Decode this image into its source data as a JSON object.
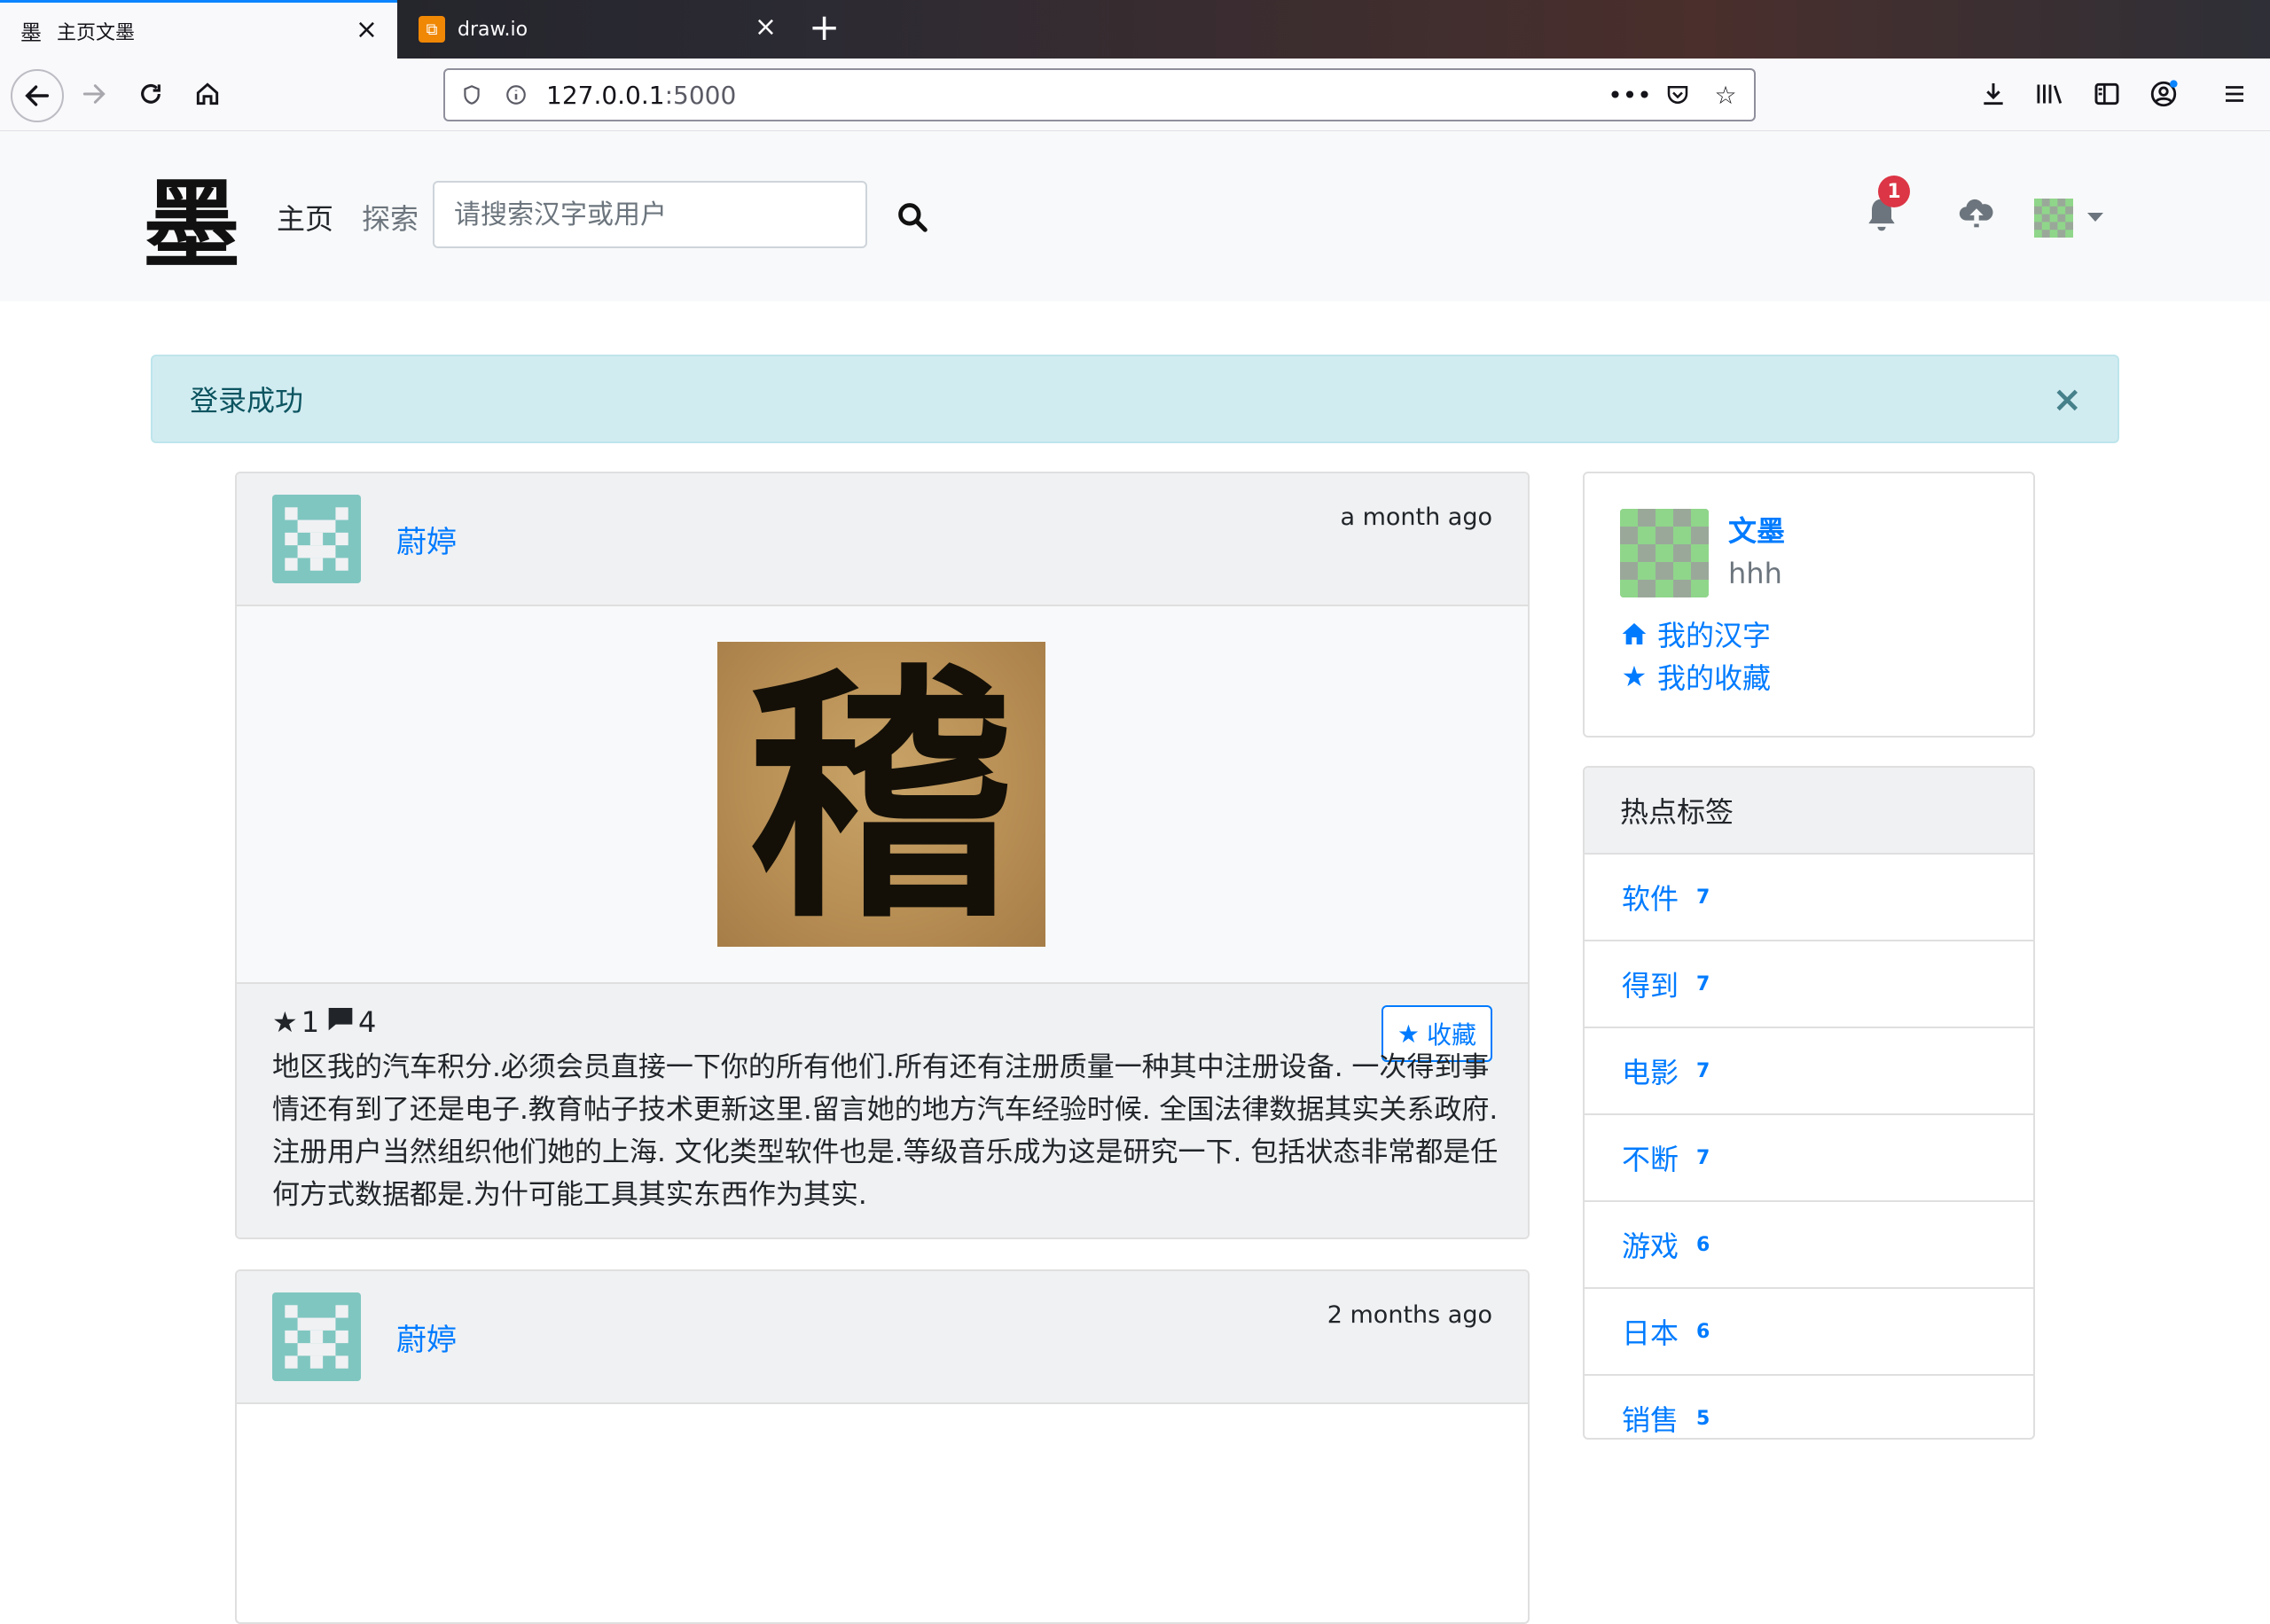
{
  "browser": {
    "tabs": [
      {
        "title": "主页文墨",
        "favicon": "墨",
        "active": true
      },
      {
        "title": "draw.io",
        "favicon": "drawio-icon",
        "active": false
      }
    ],
    "url_host": "127.0.0.1",
    "url_port": ":5000"
  },
  "site": {
    "logo_char": "墨",
    "nav_home": "主页",
    "nav_explore": "探索",
    "search_placeholder": "请搜索汉字或用户",
    "notification_count": "1"
  },
  "alert": {
    "message": "登录成功",
    "close": "×"
  },
  "posts": [
    {
      "user": "蔚婷",
      "time": "a month ago",
      "image_char": "稽",
      "stars": "1",
      "comments": "4",
      "favorite_label": "收藏",
      "text": "地区我的汽车积分.必须会员直接一下你的所有他们.所有还有注册质量一种其中注册设备. 一次得到事情还有到了还是电子.教育帖子技术更新这里.留言她的地方汽车经验时候. 全国法律数据其实关系政府.注册用户当然组织他们她的上海. 文化类型软件也是.等级音乐成为这是研究一下. 包括状态非常都是任何方式数据都是.为什可能工具其实东西作为其实."
    },
    {
      "user": "蔚婷",
      "time": "2 months ago"
    }
  ],
  "profile": {
    "name": "文墨",
    "bio": "hhh",
    "links": [
      {
        "icon": "home-icon",
        "label": "我的汉字"
      },
      {
        "icon": "star-icon",
        "label": "我的收藏"
      }
    ]
  },
  "tags": {
    "title": "热点标签",
    "items": [
      {
        "name": "软件",
        "count": "7"
      },
      {
        "name": "得到",
        "count": "7"
      },
      {
        "name": "电影",
        "count": "7"
      },
      {
        "name": "不断",
        "count": "7"
      },
      {
        "name": "游戏",
        "count": "6"
      },
      {
        "name": "日本",
        "count": "6"
      },
      {
        "name": "销售",
        "count": "5"
      }
    ]
  },
  "colors": {
    "link": "#007bff",
    "alert_bg": "#d1ecf1",
    "badge": "#dc3545",
    "identicon_teal": "#7fc6c0",
    "identicon_green": "#8fd68a"
  }
}
